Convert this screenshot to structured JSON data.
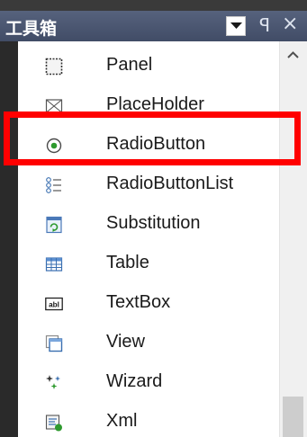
{
  "window": {
    "title": "工具箱",
    "pin_glyph": "ꟼ",
    "close_glyph": "×"
  },
  "toolbox": {
    "items": [
      {
        "label": "Panel",
        "icon": "panel-icon"
      },
      {
        "label": "PlaceHolder",
        "icon": "placeholder-icon"
      },
      {
        "label": "RadioButton",
        "icon": "radio-button-icon"
      },
      {
        "label": "RadioButtonList",
        "icon": "radio-button-list-icon"
      },
      {
        "label": "Substitution",
        "icon": "substitution-icon"
      },
      {
        "label": "Table",
        "icon": "table-icon"
      },
      {
        "label": "TextBox",
        "icon": "textbox-icon"
      },
      {
        "label": "View",
        "icon": "view-icon"
      },
      {
        "label": "Wizard",
        "icon": "wizard-icon"
      },
      {
        "label": "Xml",
        "icon": "xml-icon"
      }
    ],
    "textbox_icon_text": "abl",
    "highlighted_item": "RadioButton"
  },
  "colors": {
    "title_bar": "#4a5672",
    "highlight_border": "#ff0000",
    "list_background": "#ffffff"
  }
}
